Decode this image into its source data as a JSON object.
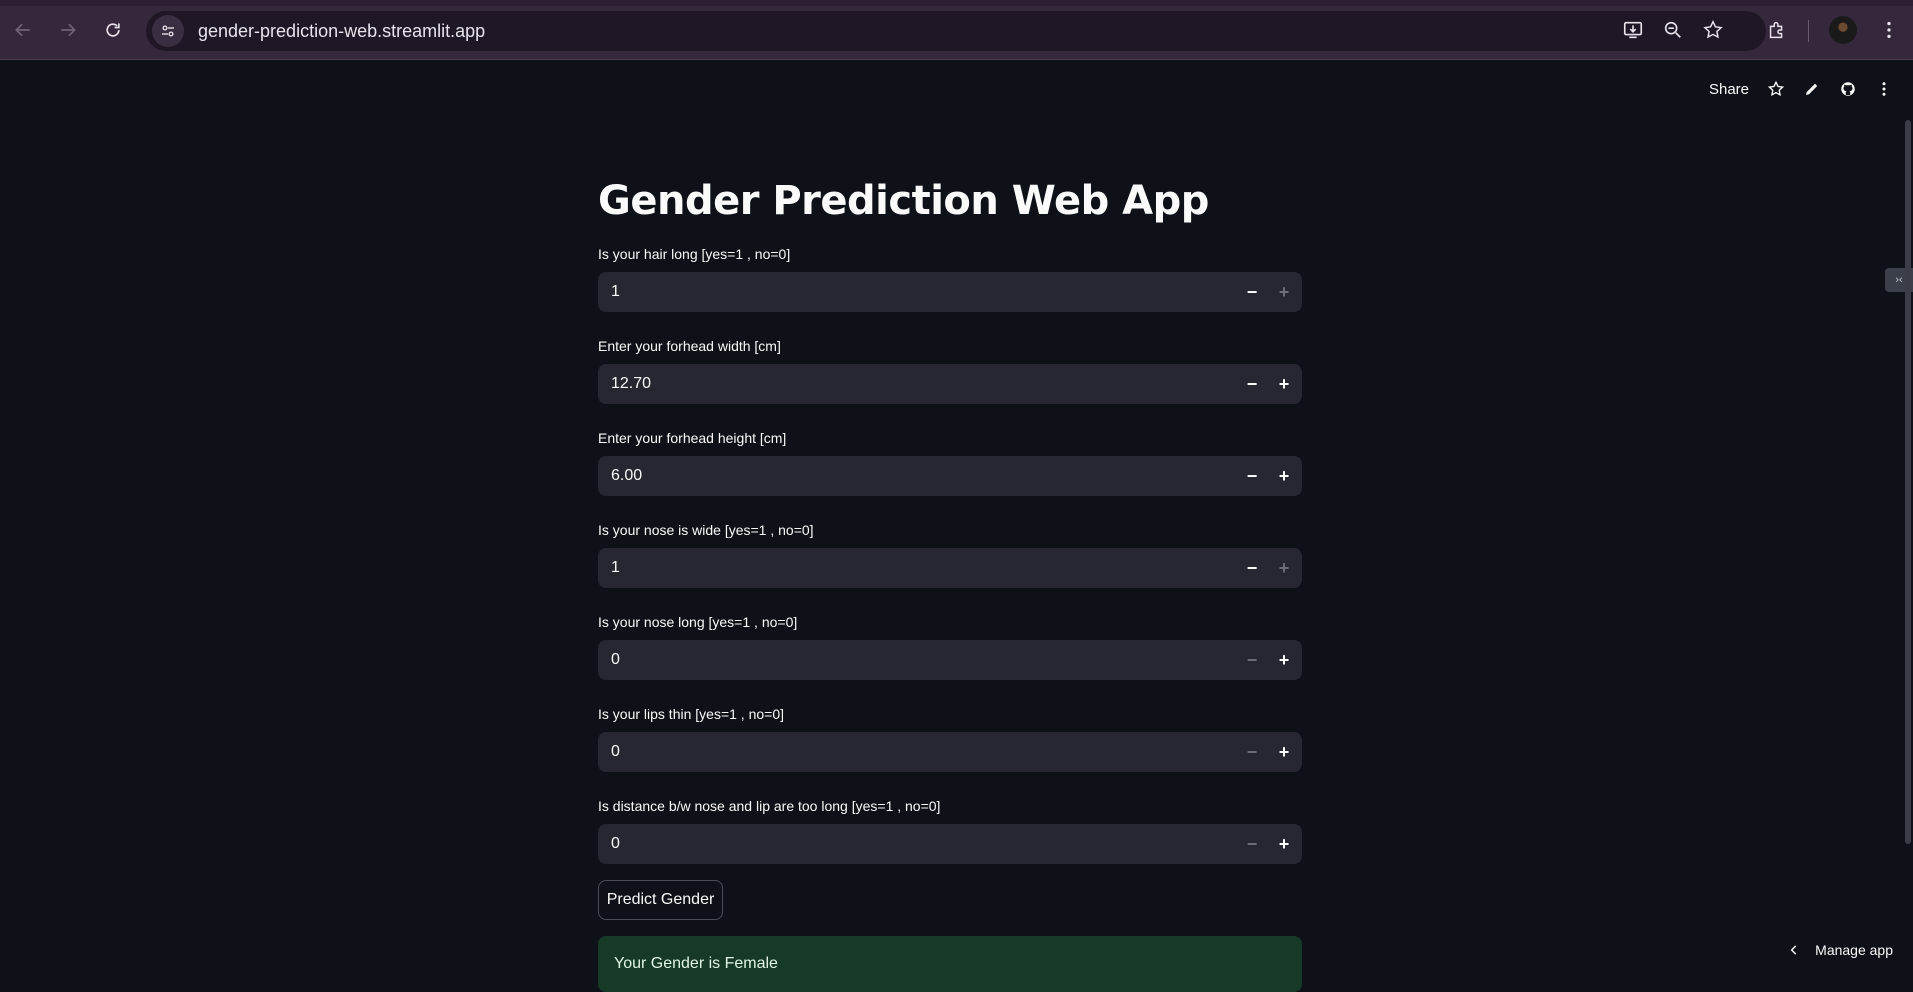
{
  "browser": {
    "url": "gender-prediction-web.streamlit.app"
  },
  "toolbar": {
    "share_label": "Share"
  },
  "app": {
    "title": "Gender Prediction Web App",
    "fields": [
      {
        "label": "Is your hair long [yes=1 , no=0]",
        "value": "1",
        "minus_enabled": true,
        "plus_enabled": false
      },
      {
        "label": "Enter your forhead width [cm]",
        "value": "12.70",
        "minus_enabled": true,
        "plus_enabled": true
      },
      {
        "label": "Enter your forhead height [cm]",
        "value": "6.00",
        "minus_enabled": true,
        "plus_enabled": true
      },
      {
        "label": "Is your nose is wide [yes=1 , no=0]",
        "value": "1",
        "minus_enabled": true,
        "plus_enabled": false
      },
      {
        "label": "Is your nose long [yes=1 , no=0]",
        "value": "0",
        "minus_enabled": false,
        "plus_enabled": true
      },
      {
        "label": "Is your lips thin [yes=1 , no=0]",
        "value": "0",
        "minus_enabled": false,
        "plus_enabled": true
      },
      {
        "label": "Is distance b/w nose and lip are too long [yes=1 , no=0]",
        "value": "0",
        "minus_enabled": false,
        "plus_enabled": true
      }
    ],
    "stepper": {
      "minus": "−",
      "plus": "+"
    },
    "predict_button": "Predict Gender",
    "result": "Your Gender is Female"
  },
  "footer": {
    "manage_app": "Manage app"
  },
  "side_tab": "›‹"
}
